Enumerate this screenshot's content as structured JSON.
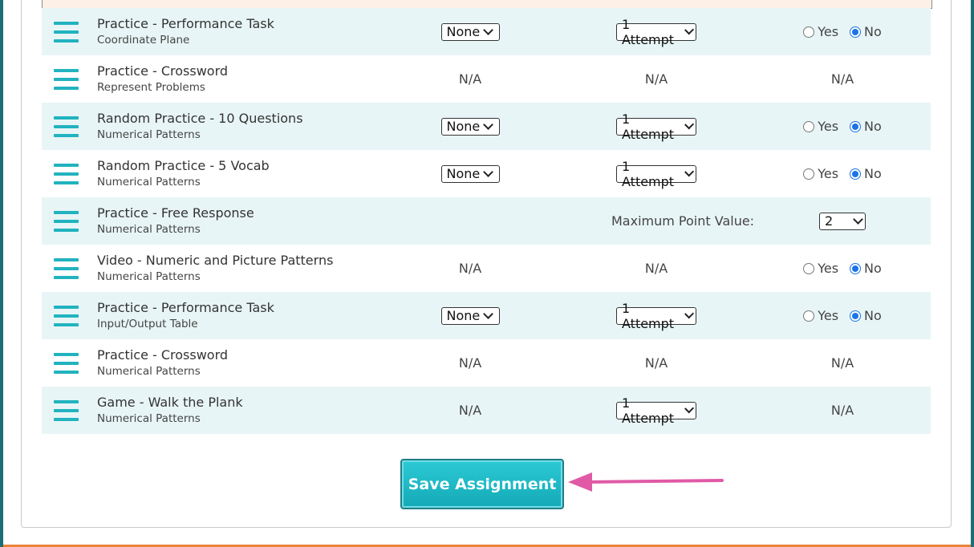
{
  "rows": [
    {
      "title": "Practice - Performance Task",
      "subtitle": "Coordinate Plane",
      "type": "select",
      "col1": "None",
      "col2": "1 Attempt",
      "yes": "Yes",
      "no": "No",
      "selected": "no"
    },
    {
      "title": "Practice - Crossword",
      "subtitle": "Represent Problems",
      "type": "na",
      "col1": "N/A",
      "col2": "N/A",
      "col3": "N/A"
    },
    {
      "title": "Random Practice - 10 Questions",
      "subtitle": "Numerical Patterns",
      "type": "select",
      "col1": "None",
      "col2": "1 Attempt",
      "yes": "Yes",
      "no": "No",
      "selected": "no"
    },
    {
      "title": "Random Practice - 5 Vocab",
      "subtitle": "Numerical Patterns",
      "type": "select",
      "col1": "None",
      "col2": "1 Attempt",
      "yes": "Yes",
      "no": "No",
      "selected": "no"
    },
    {
      "title": "Practice - Free Response",
      "subtitle": "Numerical Patterns",
      "type": "points",
      "label": "Maximum Point Value:",
      "value": "2"
    },
    {
      "title": "Video - Numeric and Picture Patterns",
      "subtitle": "Numerical Patterns",
      "type": "na-radio",
      "col1": "N/A",
      "col2": "N/A",
      "yes": "Yes",
      "no": "No",
      "selected": "no"
    },
    {
      "title": "Practice - Performance Task",
      "subtitle": "Input/Output Table",
      "type": "select",
      "col1": "None",
      "col2": "1 Attempt",
      "yes": "Yes",
      "no": "No",
      "selected": "no"
    },
    {
      "title": "Practice - Crossword",
      "subtitle": "Numerical Patterns",
      "type": "na",
      "col1": "N/A",
      "col2": "N/A",
      "col3": "N/A"
    },
    {
      "title": "Game - Walk the Plank",
      "subtitle": "Numerical Patterns",
      "type": "game",
      "col1": "N/A",
      "col2": "1 Attempt",
      "col3": "N/A"
    }
  ],
  "save_button": {
    "label": "Save Assignment"
  },
  "colors": {
    "accent": "#21b3bf",
    "row_alt": "#e8f5f6",
    "arrow": "#e05aa6"
  }
}
